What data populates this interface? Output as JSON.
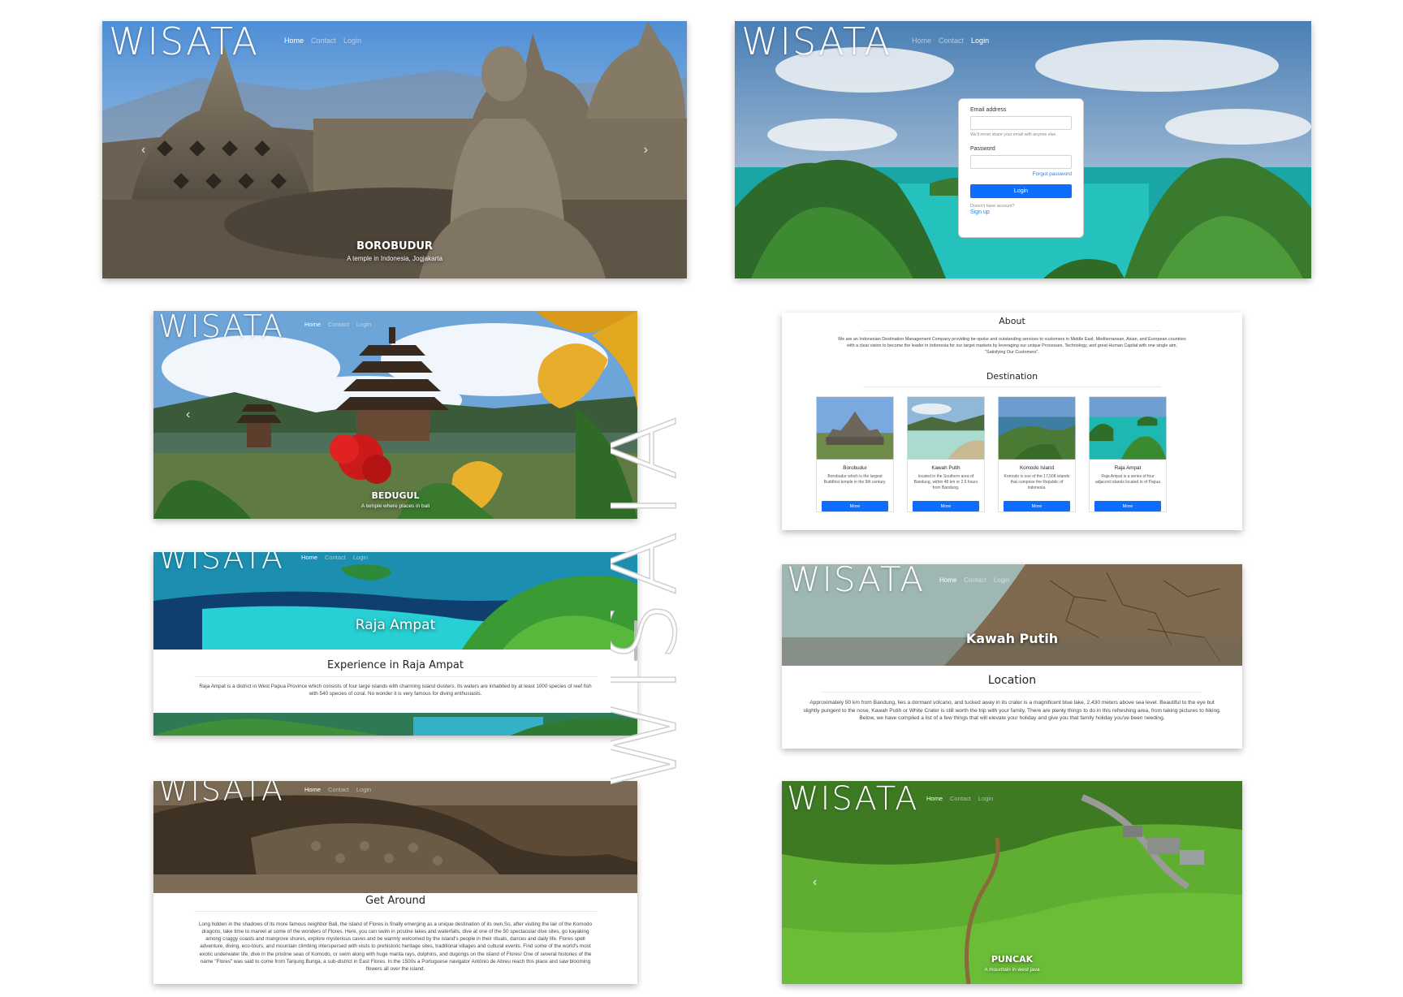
{
  "brand": "WISATA",
  "nav": {
    "home": "Home",
    "contact": "Contact",
    "login": "Login"
  },
  "watermark": "WISATA",
  "borobudur": {
    "title": "BOROBUDUR",
    "subtitle": "A temple in Indonesia, Jogjakarta"
  },
  "login": {
    "email_label": "Email address",
    "email_help": "We'll never share your email with anyone else.",
    "password_label": "Password",
    "forgot": "Forgot password",
    "button": "Login",
    "no_account": "Doesn't have account?",
    "signup": "Sign up"
  },
  "bedugul": {
    "title": "BEDUGUL",
    "subtitle": "A temple where places in bali"
  },
  "about": {
    "title": "About",
    "text": "We are an Indonesian Destination Management Company providing be-spoke and outstanding services to customers in Middle East, Mediterranean, Asian, and European countries with a clear vision to become the leader in Indonesia for our target markets by leveraging our unique Processes, Technology, and great Human Capital with one single aim, \"Satisfying Our Customers\".",
    "destination_title": "Destination",
    "cards": [
      {
        "name": "Borobudur",
        "desc": "Borobudur which is the largest Buddhist temple in the 9th century.",
        "button": "More"
      },
      {
        "name": "Kawah Putih",
        "desc": "located in the Southern area of Bandung, within 48 km or 2.5 hours from Bandung.",
        "button": "More"
      },
      {
        "name": "Komodo Island",
        "desc": "Komodo is one of the 17,508 islands that comprise the Republic of Indonesia.",
        "button": "More"
      },
      {
        "name": "Raja Ampat",
        "desc": "Raja Ampat is a series of four adjacent islands located in of Papua",
        "button": "More"
      }
    ]
  },
  "raja": {
    "hero_title": "Raja Ampat",
    "heading": "Experience in Raja Ampat",
    "text": "Raja Ampat is a district in West Papua Province which consists of four large islands with charming island clusters. Its waters are inhabited by at least 1000 species of reef fish with 540 species of coral. No wonder it is very famous for diving enthusiasts."
  },
  "kawah": {
    "hero_title": "Kawah Putih",
    "heading": "Location",
    "text": "Approximately 50 km from Bandung, lies a dormant volcano, and tucked away in its crater is a magnificent blue lake, 2,430 meters above sea level. Beautiful to the eye but slightly pungent to the nose, Kawah Putih or White Crater is still worth the trip with your family. There are plenty things to do in this refreshing area, from taking pictures to hiking. Below, we have compiled a list of a few things that will elevate your holiday and give you that family holiday you've been needing."
  },
  "komodo": {
    "heading": "Get Around",
    "text": "Long hidden in the shadows of its more famous neighbor Bali, the island of Flores is finally emerging as a unique destination of its own.So, after visiting the lair of the Komodo dragons, take time to marvel at some of the wonders of Flores. Here, you can swim in pristine lakes and waterfalls, dive at one of the 50 spectacular dive sites, go kayaking among craggy coasts and mangrove shores, explore mysterious caves and be warmly welcomed by the island's people in their rituals, dances and daily life. Flores spell adventure, diving, eco-tours, and mountain climbing interspersed with visits to prehistoric heritage sites, traditional villages and cultural events. Find some of the world's most exotic underwater life, dive in the pristine seas of Komodo, or swim along with huge manta rays, dolphins, and dugongs on the island of Flores! One of several histories of the name \"Flores\" was said to come from Tanjung Bunga, a sub-district in East Flores. In the 1500s a Portuguese navigator António de Abreu reach this place and saw blooming flowers all over the island."
  },
  "puncak": {
    "title": "PUNCAK",
    "subtitle": "A mountain in west java"
  }
}
